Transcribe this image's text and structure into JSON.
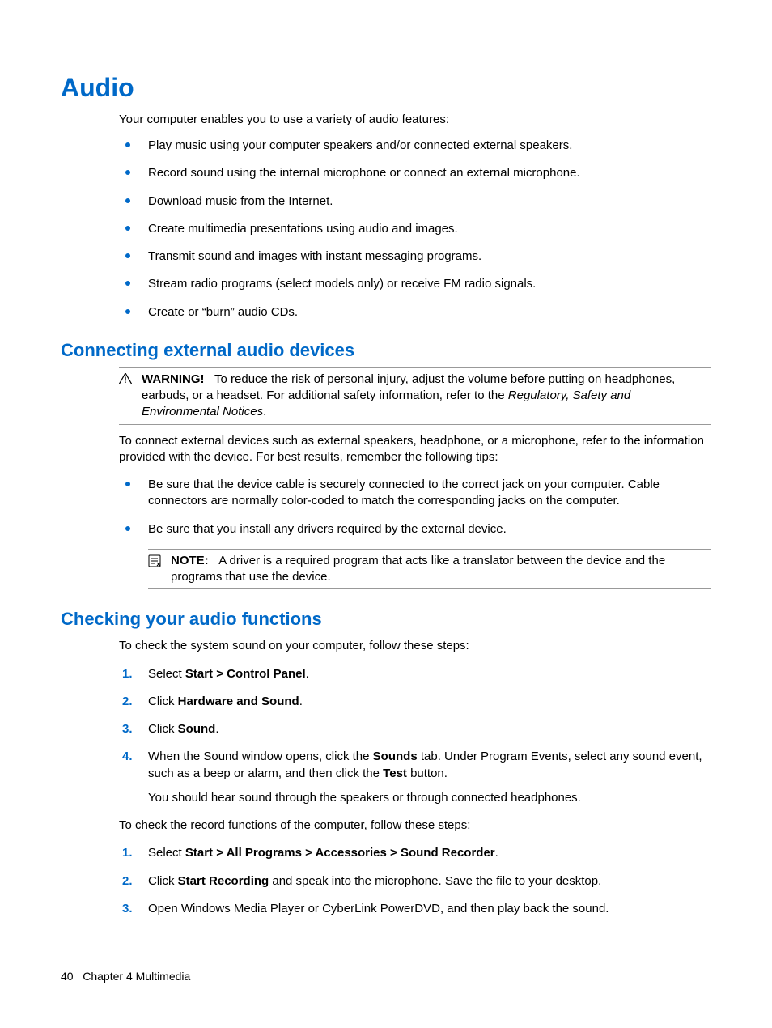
{
  "heading_main": "Audio",
  "intro": "Your computer enables you to use a variety of audio features:",
  "features": [
    "Play music using your computer speakers and/or connected external speakers.",
    "Record sound using the internal microphone or connect an external microphone.",
    "Download music from the Internet.",
    "Create multimedia presentations using audio and images.",
    "Transmit sound and images with instant messaging programs.",
    "Stream radio programs (select models only) or receive FM radio signals.",
    "Create or “burn” audio CDs."
  ],
  "heading_connect": "Connecting external audio devices",
  "warning": {
    "label": "WARNING!",
    "body_before": "To reduce the risk of personal injury, adjust the volume before putting on headphones, earbuds, or a headset. For additional safety information, refer to the ",
    "italic": "Regulatory, Safety and Environmental Notices",
    "body_after": "."
  },
  "connect_intro": "To connect external devices such as external speakers, headphone, or a microphone, refer to the information provided with the device. For best results, remember the following tips:",
  "connect_tips": [
    "Be sure that the device cable is securely connected to the correct jack on your computer. Cable connectors are normally color-coded to match the corresponding jacks on the computer.",
    "Be sure that you install any drivers required by the external device."
  ],
  "note": {
    "label": "NOTE:",
    "body": "A driver is a required program that acts like a translator between the device and the programs that use the device."
  },
  "heading_check": "Checking your audio functions",
  "check_intro": "To check the system sound on your computer, follow these steps:",
  "steps1": {
    "s1_pre": "Select ",
    "s1_bold": "Start > Control Panel",
    "s1_post": ".",
    "s2_pre": "Click ",
    "s2_bold": "Hardware and Sound",
    "s2_post": ".",
    "s3_pre": "Click ",
    "s3_bold": "Sound",
    "s3_post": ".",
    "s4_pre": "When the Sound window opens, click the ",
    "s4_bold1": "Sounds",
    "s4_mid": " tab. Under Program Events, select any sound event, such as a beep or alarm, and then click the ",
    "s4_bold2": "Test",
    "s4_post": " button.",
    "s4_sub": "You should hear sound through the speakers or through connected headphones."
  },
  "check_record_intro": "To check the record functions of the computer, follow these steps:",
  "steps2": {
    "s1_pre": "Select ",
    "s1_bold": "Start > All Programs > Accessories > Sound Recorder",
    "s1_post": ".",
    "s2_pre": "Click ",
    "s2_bold": "Start Recording",
    "s2_post": " and speak into the microphone. Save the file to your desktop.",
    "s3": "Open Windows Media Player or CyberLink PowerDVD, and then play back the sound."
  },
  "footer": {
    "page": "40",
    "chapter": "Chapter 4   Multimedia"
  }
}
